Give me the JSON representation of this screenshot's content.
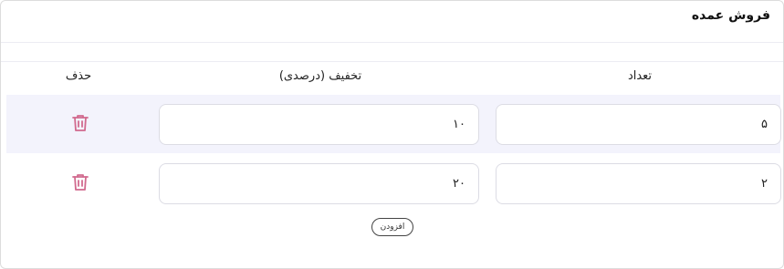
{
  "card": {
    "title": "فروش عمده"
  },
  "table": {
    "headers": {
      "quantity": "تعداد",
      "discount": "تخفیف (درصدی)",
      "delete": "حذف"
    },
    "rows": [
      {
        "quantity": "۵",
        "discount": "۱۰"
      },
      {
        "quantity": "۲",
        "discount": "۲۰"
      }
    ]
  },
  "actions": {
    "add_label": "افزودن"
  },
  "colors": {
    "delete_icon": "#d16a8e",
    "row_highlight": "#f3f3fc",
    "border": "#dcdce4"
  },
  "icons": {
    "delete": "trash-icon"
  }
}
